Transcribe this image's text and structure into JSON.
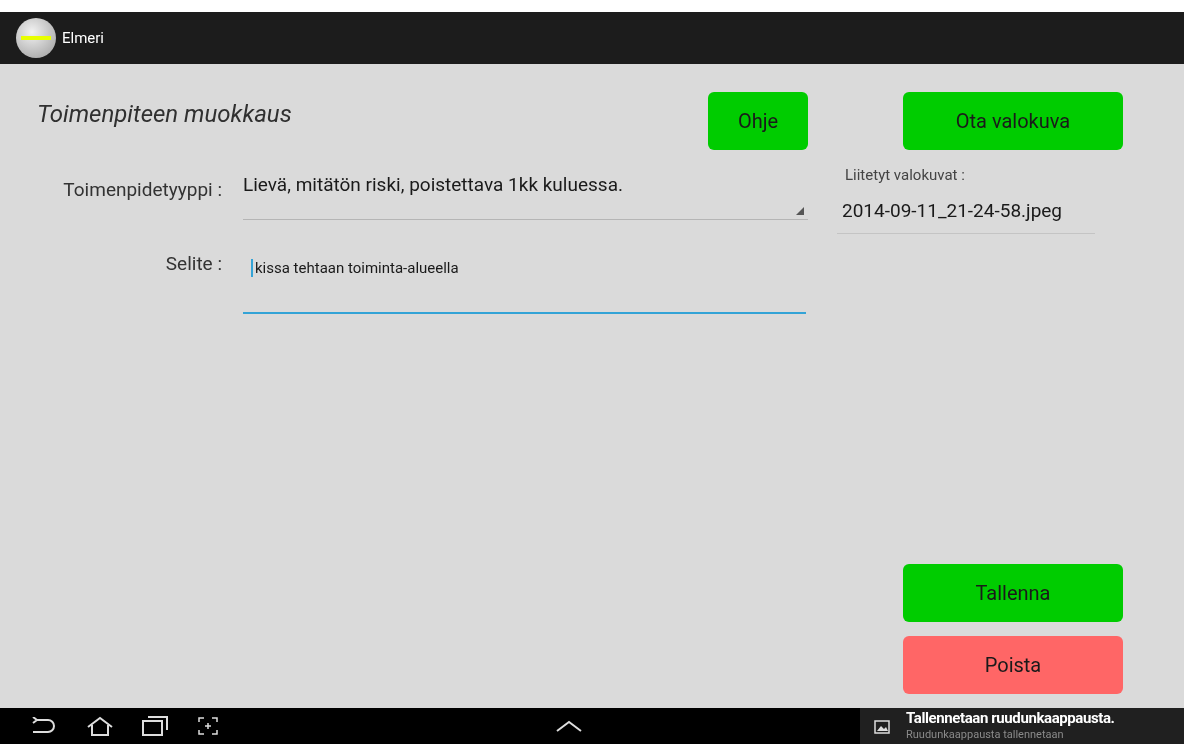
{
  "app_bar": {
    "title": "Elmeri"
  },
  "form": {
    "title": "Toimenpiteen muokkaus",
    "help_button": "Ohje",
    "type_label": "Toimenpidetyyppi :",
    "type_value": "Lievä, mitätön riski, poistettava 1kk kuluessa.",
    "description_label": "Selite :",
    "description_value": "kissa tehtaan toiminta-alueella",
    "description_focused": true
  },
  "photos": {
    "take_photo_button": "Ota valokuva",
    "attached_label": "Liitetyt valokuvat :",
    "files": [
      "2014-09-11_21-24-58.jpeg"
    ]
  },
  "actions": {
    "save_button": "Tallenna",
    "delete_button": "Poista"
  },
  "notification": {
    "title": "Tallennetaan ruudunkaappausta.",
    "subtitle": "Ruudunkaappausta tallennetaan"
  }
}
